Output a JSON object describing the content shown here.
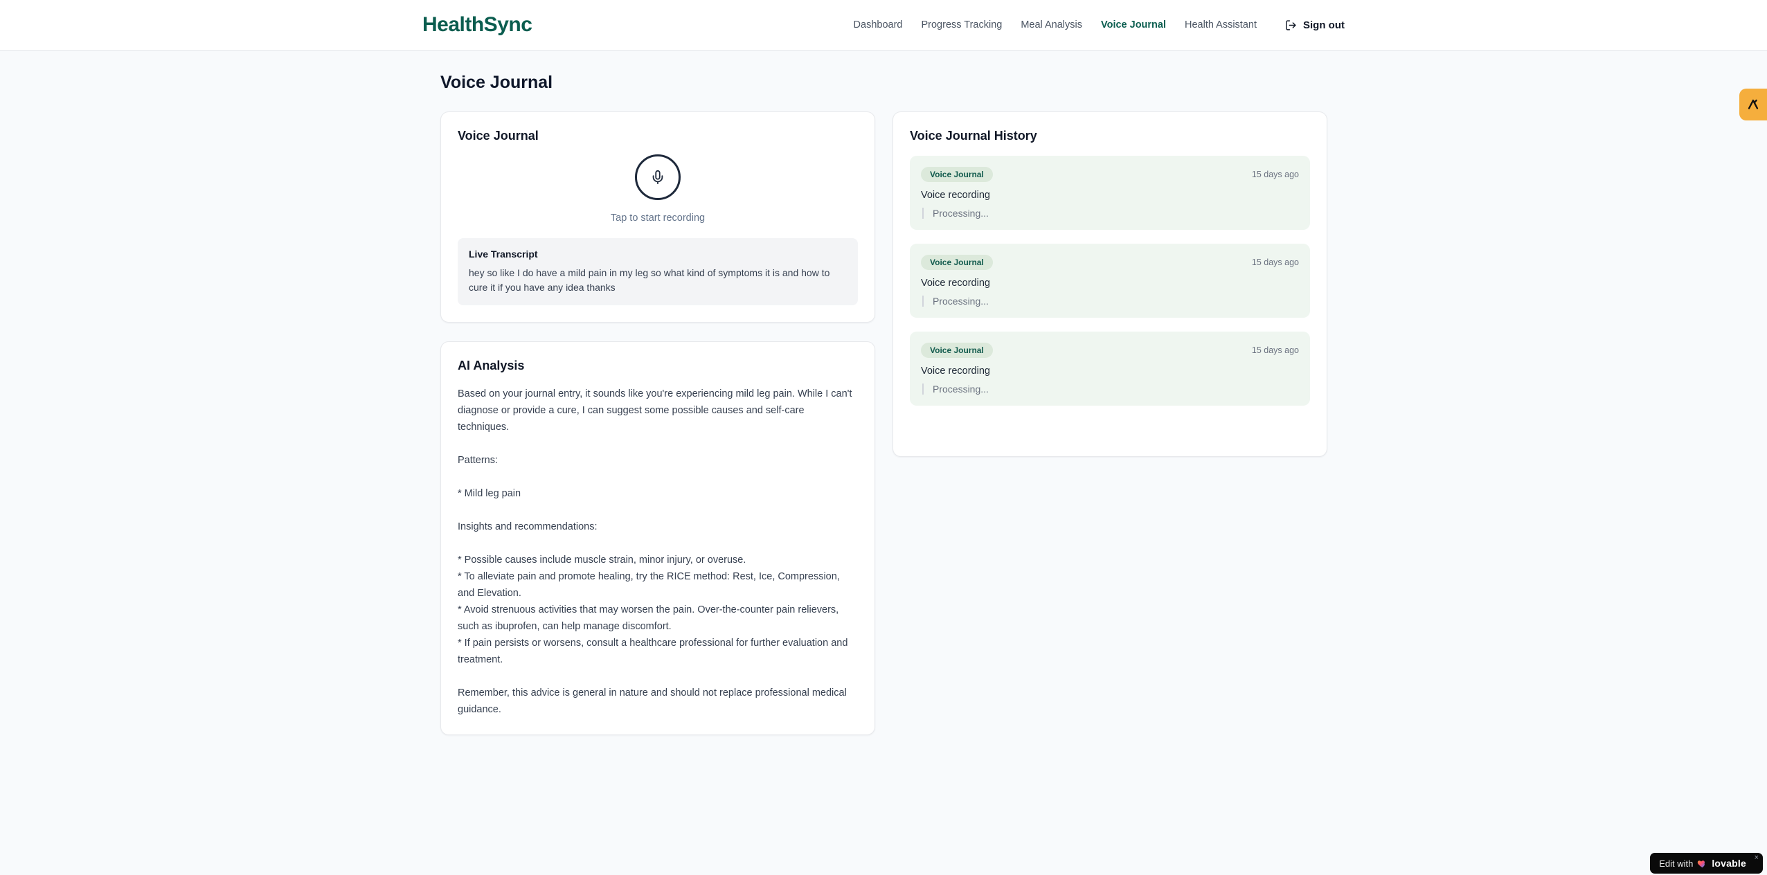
{
  "brand": {
    "name": "HealthSync",
    "accent_color": "#0b5d4f"
  },
  "nav": {
    "items": [
      {
        "label": "Dashboard",
        "active": false
      },
      {
        "label": "Progress Tracking",
        "active": false
      },
      {
        "label": "Meal Analysis",
        "active": false
      },
      {
        "label": "Voice Journal",
        "active": true
      },
      {
        "label": "Health Assistant",
        "active": false
      }
    ],
    "signout_label": "Sign out",
    "signout_icon": "logout-icon"
  },
  "page": {
    "title": "Voice Journal"
  },
  "recorder_card": {
    "title": "Voice Journal",
    "mic_icon": "microphone-icon",
    "tap_hint": "Tap to start recording",
    "transcript": {
      "title": "Live Transcript",
      "text": "hey so like I do have a mild pain in my leg so what kind of symptoms it is and how to cure it if you have any idea thanks"
    }
  },
  "analysis_card": {
    "title": "AI Analysis",
    "body": "Based on your journal entry, it sounds like you're experiencing mild leg pain. While I can't diagnose or provide a cure, I can suggest some possible causes and self-care techniques.\n\nPatterns:\n\n* Mild leg pain\n\nInsights and recommendations:\n\n* Possible causes include muscle strain, minor injury, or overuse.\n* To alleviate pain and promote healing, try the RICE method: Rest, Ice, Compression, and Elevation.\n* Avoid strenuous activities that may worsen the pain. Over-the-counter pain relievers, such as ibuprofen, can help manage discomfort.\n* If pain persists or worsens, consult a healthcare professional for further evaluation and treatment.\n\nRemember, this advice is general in nature and should not replace professional medical guidance."
  },
  "history_card": {
    "title": "Voice Journal History",
    "entries": [
      {
        "badge": "Voice Journal",
        "time": "15 days ago",
        "title": "Voice recording",
        "status": "Processing..."
      },
      {
        "badge": "Voice Journal",
        "time": "15 days ago",
        "title": "Voice recording",
        "status": "Processing..."
      },
      {
        "badge": "Voice Journal",
        "time": "15 days ago",
        "title": "Voice recording",
        "status": "Processing..."
      }
    ]
  },
  "widgets": {
    "side_tab_icon": "lovable-logo-icon",
    "edit_badge": {
      "prefix": "Edit with",
      "heart_icon": "gradient-heart-icon",
      "brand": "lovable",
      "close": "×"
    }
  },
  "colors": {
    "accent": "#0b5d4f",
    "entry_bg": "#eff6f0",
    "badge_bg": "#dce9db",
    "badge_text": "#135c4e",
    "side_tab": "#f5ae3d",
    "page_bg": "#f8fafc"
  }
}
